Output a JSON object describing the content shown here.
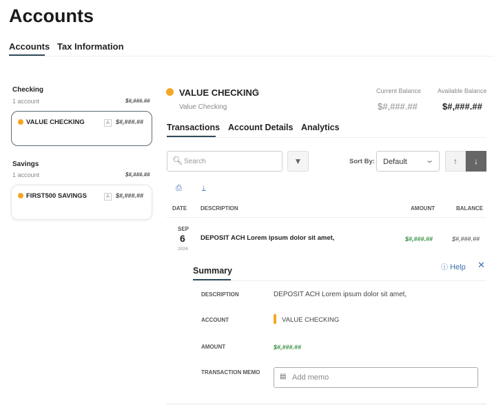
{
  "page": {
    "title": "Accounts",
    "tabs": [
      "Accounts",
      "Tax Information"
    ]
  },
  "sidebar": {
    "groups": [
      {
        "name": "Checking",
        "count": "1 account",
        "total": "$#,###.##",
        "account": {
          "name": "VALUE CHECKING",
          "badge": "A",
          "balance": "$#,###.##"
        }
      },
      {
        "name": "Savings",
        "count": "1 account",
        "total": "$#,###.##",
        "account": {
          "name": "FIRST500 SAVINGS",
          "badge": "A",
          "balance": "$#,###.##"
        }
      }
    ]
  },
  "account": {
    "name": "VALUE CHECKING",
    "subtitle": "Value Checking",
    "current_label": "Current Balance",
    "current": "$#,###.##",
    "available_label": "Available Balance",
    "available": "$#,###.##",
    "tabs": [
      "Transactions",
      "Account Details",
      "Analytics"
    ]
  },
  "toolbar": {
    "search_placeholder": "Search",
    "sort_label": "Sort By:",
    "sort_value": "Default"
  },
  "table": {
    "headers": [
      "DATE",
      "DESCRIPTION",
      "AMOUNT",
      "BALANCE"
    ],
    "rows": [
      {
        "month": "SEP",
        "day": "6",
        "year": "2024",
        "description": "DEPOSIT ACH Lorem ipsum dolor sit amet,",
        "amount": "$#,###.##",
        "balance": "$#,###.##"
      }
    ]
  },
  "summary": {
    "title": "Summary",
    "help": "Help",
    "fields": [
      {
        "label": "DESCRIPTION",
        "value": "DEPOSIT ACH Lorem ipsum dolor sit amet,"
      },
      {
        "label": "ACCOUNT",
        "value": "VALUE CHECKING"
      },
      {
        "label": "AMOUNT",
        "value": "$#,###.##"
      },
      {
        "label": "TRANSACTION MEMO",
        "placeholder": "Add memo"
      }
    ]
  },
  "colors": {
    "accent": "#f5a623",
    "tab_underline": "#2f4a5a",
    "green": "#2e8b3a"
  }
}
